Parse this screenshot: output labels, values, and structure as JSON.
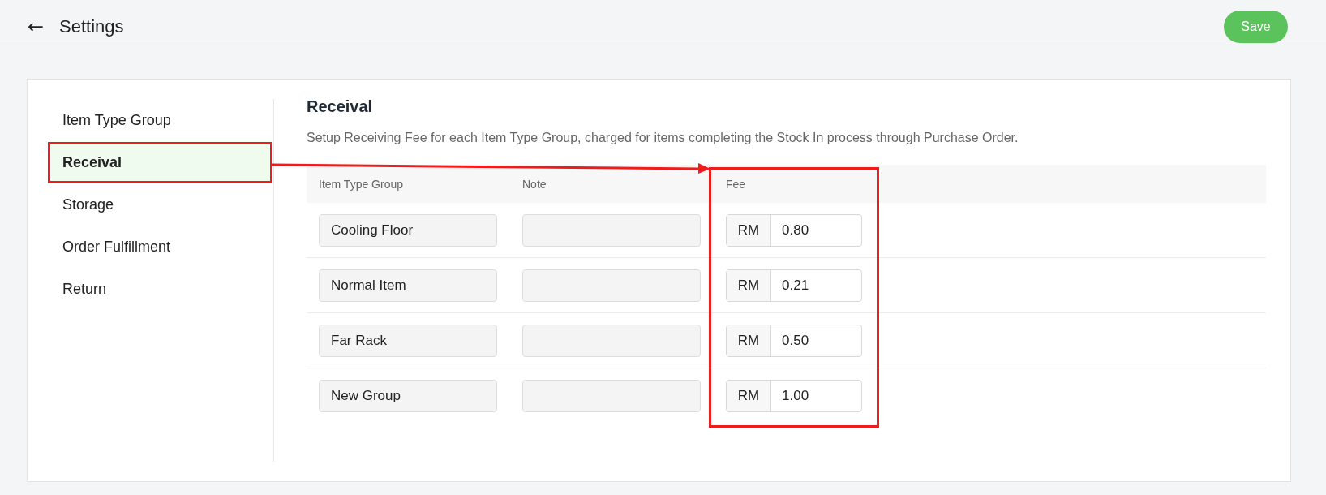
{
  "header": {
    "back": "←",
    "title": "Settings",
    "save_label": "Save"
  },
  "sidebar": {
    "items": [
      {
        "label": "Item Type Group",
        "selected": false
      },
      {
        "label": "Receival",
        "selected": true
      },
      {
        "label": "Storage",
        "selected": false
      },
      {
        "label": "Order Fulfillment",
        "selected": false
      },
      {
        "label": "Return",
        "selected": false
      }
    ]
  },
  "section": {
    "title": "Receival",
    "description": "Setup Receiving Fee for each Item Type Group, charged for items completing the Stock In process through Purchase Order."
  },
  "table": {
    "columns": [
      "Item Type Group",
      "Note",
      "Fee"
    ],
    "rows": [
      {
        "group": "Cooling Floor",
        "currency": "RM",
        "fee": "0.80"
      },
      {
        "group": "Normal Item",
        "currency": "RM",
        "fee": "0.21"
      },
      {
        "group": "Far Rack",
        "currency": "RM",
        "fee": "0.50"
      },
      {
        "group": "New Group",
        "currency": "RM",
        "fee": "1.00"
      }
    ]
  },
  "annotations": [
    {
      "kind": "itembox"
    },
    {
      "kind": "arrow"
    },
    {
      "kind": "columnbox"
    }
  ]
}
